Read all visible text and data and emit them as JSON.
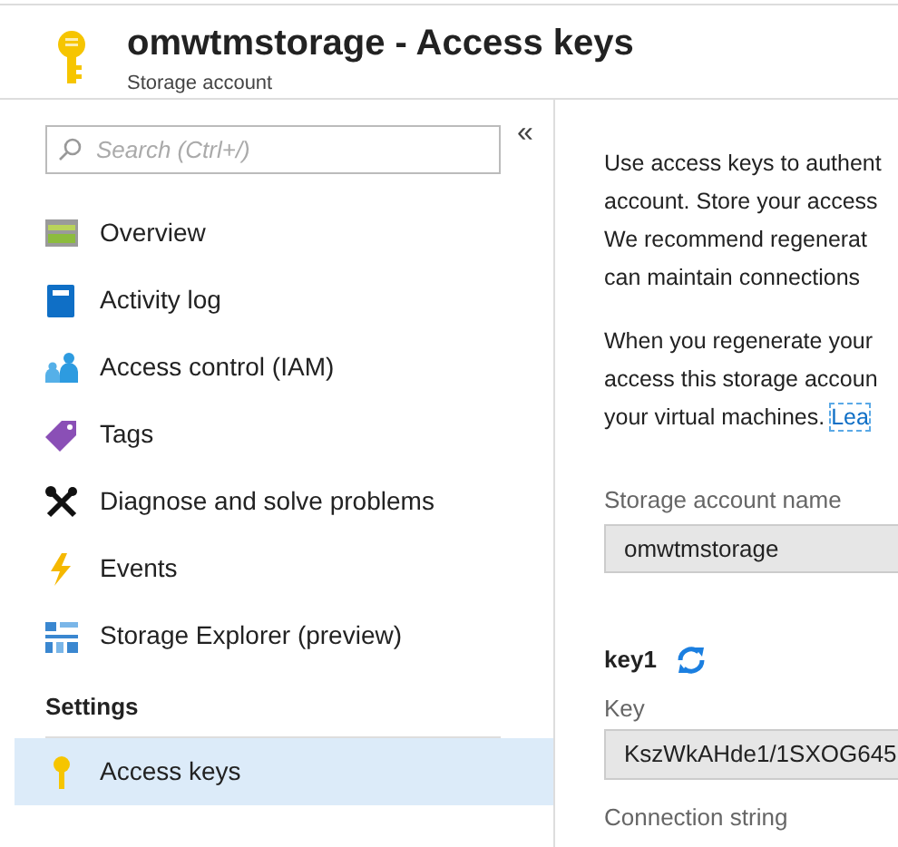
{
  "header": {
    "title": "omwtmstorage - Access keys",
    "subtitle": "Storage account"
  },
  "sidebar": {
    "search": {
      "placeholder": "Search (Ctrl+/)"
    },
    "collapse": "«",
    "items": [
      {
        "label": "Overview",
        "selected": false
      },
      {
        "label": "Activity log",
        "selected": false
      },
      {
        "label": "Access control (IAM)",
        "selected": false
      },
      {
        "label": "Tags",
        "selected": false
      },
      {
        "label": "Diagnose and solve problems",
        "selected": false
      },
      {
        "label": "Events",
        "selected": false
      },
      {
        "label": "Storage Explorer (preview)",
        "selected": false
      }
    ],
    "sections": [
      {
        "title": "Settings",
        "items": [
          {
            "label": "Access keys",
            "selected": true
          }
        ]
      }
    ]
  },
  "content": {
    "paragraphs": [
      {
        "lines": [
          "Use access keys to authent",
          "account. Store your access",
          "We recommend regenerat",
          "can maintain connections"
        ]
      },
      {
        "lines": [
          "When you regenerate your",
          "access this storage accoun",
          "your virtual machines."
        ],
        "link": "Lea"
      }
    ],
    "account_name": {
      "label": "Storage account name",
      "value": "omwtmstorage"
    },
    "key1": {
      "title": "key1",
      "key_label": "Key",
      "key_value": "KszWkAHde1/1SXOG645",
      "connection_label": "Connection string"
    }
  }
}
